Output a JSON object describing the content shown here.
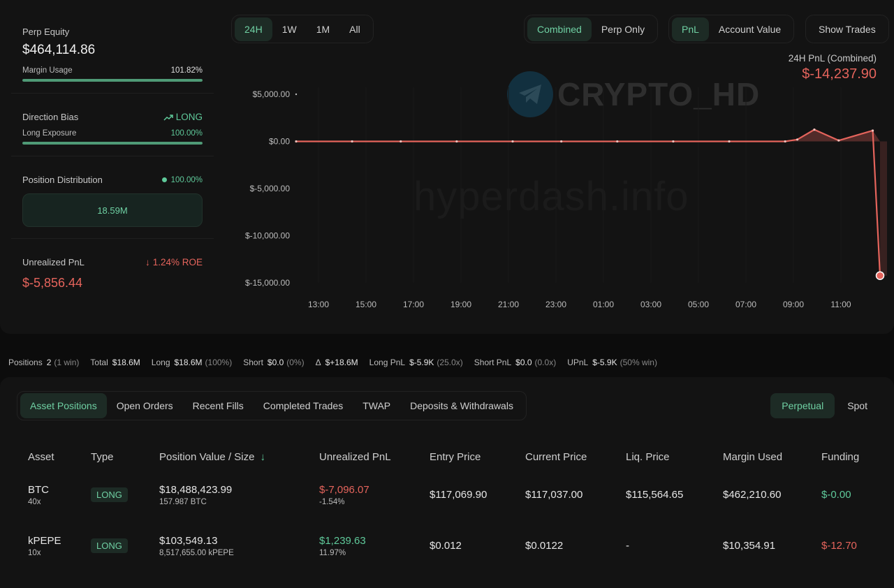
{
  "summary": {
    "perp_equity_label": "Perp Equity",
    "perp_equity_value": "$464,114.86",
    "margin_usage_label": "Margin Usage",
    "margin_usage_value": "101.82%",
    "margin_usage_fill": 1.0,
    "direction_bias_label": "Direction Bias",
    "direction_bias_value": "LONG",
    "long_exposure_label": "Long Exposure",
    "long_exposure_value": "100.00%",
    "long_exposure_fill": 1.0,
    "position_distribution_label": "Position Distribution",
    "position_distribution_pct": "100.00%",
    "position_distribution_value": "18.59M",
    "unrealized_pnl_label": "Unrealized PnL",
    "unrealized_pnl_roe": "1.24% ROE",
    "unrealized_pnl_value": "$-5,856.44"
  },
  "range_tabs": [
    "24H",
    "1W",
    "1M",
    "All"
  ],
  "range_active": "24H",
  "view_tabs": [
    "Combined",
    "Perp Only"
  ],
  "metric_tabs": [
    "PnL",
    "Account Value"
  ],
  "show_trades_label": "Show Trades",
  "pnl_header": {
    "title": "24H PnL (Combined)",
    "value": "$-14,237.90"
  },
  "watermarks": {
    "brand": "CRYPTO_HD",
    "site": "hyperdash.info"
  },
  "colors": {
    "accent_green": "#5fc99a",
    "loss_red": "#e5645c"
  },
  "chart_data": {
    "type": "area",
    "y_ticks": [
      "$5,000.00",
      "$0.00",
      "$-5,000.00",
      "$-10,000.00",
      "$-15,000.00"
    ],
    "y_tick_values": [
      5000,
      0,
      -5000,
      -10000,
      -15000
    ],
    "ylim": [
      -15000,
      5000
    ],
    "x_ticks": [
      "13:00",
      "15:00",
      "17:00",
      "19:00",
      "21:00",
      "23:00",
      "01:00",
      "03:00",
      "05:00",
      "07:00",
      "09:00",
      "11:00"
    ],
    "xlim": [
      0,
      24
    ],
    "series": [
      {
        "values": [
          [
            0,
            0
          ],
          [
            2.3,
            0
          ],
          [
            4.3,
            0
          ],
          [
            6.6,
            0
          ],
          [
            8.9,
            0
          ],
          [
            10.9,
            0
          ],
          [
            13.2,
            0
          ],
          [
            15.5,
            0
          ],
          [
            17.8,
            0
          ],
          [
            20.1,
            0
          ],
          [
            20.6,
            200
          ],
          [
            21.3,
            1250
          ],
          [
            22.3,
            100
          ],
          [
            23.7,
            1150
          ],
          [
            24,
            -14237.9
          ]
        ]
      }
    ]
  },
  "stats_bar": {
    "positions_label": "Positions",
    "positions_value": "2",
    "positions_note": "(1 win)",
    "total_label": "Total",
    "total_value": "$18.6M",
    "long_label": "Long",
    "long_value": "$18.6M",
    "long_note": "(100%)",
    "short_label": "Short",
    "short_value": "$0.0",
    "short_note": "(0%)",
    "delta_label": "Δ",
    "delta_value": "$+18.6M",
    "long_pnl_label": "Long PnL",
    "long_pnl_value": "$-5.9K",
    "long_pnl_note": "(25.0x)",
    "short_pnl_label": "Short PnL",
    "short_pnl_value": "$0.0",
    "short_pnl_note": "(0.0x)",
    "upnl_label": "UPnL",
    "upnl_value": "$-5.9K",
    "upnl_note": "(50% win)"
  },
  "bottom_tabs": [
    "Asset Positions",
    "Open Orders",
    "Recent Fills",
    "Completed Trades",
    "TWAP",
    "Deposits & Withdrawals"
  ],
  "bottom_tab_active": "Asset Positions",
  "market_tabs": [
    "Perpetual",
    "Spot"
  ],
  "market_tab_active": "Perpetual",
  "table": {
    "headers": [
      "Asset",
      "Type",
      "Position Value / Size",
      "Unrealized PnL",
      "Entry Price",
      "Current Price",
      "Liq. Price",
      "Margin Used",
      "Funding"
    ],
    "rows": [
      {
        "asset": "BTC",
        "leverage": "40x",
        "type": "LONG",
        "value": "$18,488,423.99",
        "size": "157.987 BTC",
        "pnl": "$-7,096.07",
        "pnl_pct": "-1.54%",
        "entry": "$117,069.90",
        "current": "$117,037.00",
        "liq": "$115,564.65",
        "margin": "$462,210.60",
        "funding": "$-0.00"
      },
      {
        "asset": "kPEPE",
        "leverage": "10x",
        "type": "LONG",
        "value": "$103,549.13",
        "size": "8,517,655.00 kPEPE",
        "pnl": "$1,239.63",
        "pnl_pct": "11.97%",
        "entry": "$0.012",
        "current": "$0.0122",
        "liq": "-",
        "margin": "$10,354.91",
        "funding": "$-12.70"
      }
    ]
  }
}
